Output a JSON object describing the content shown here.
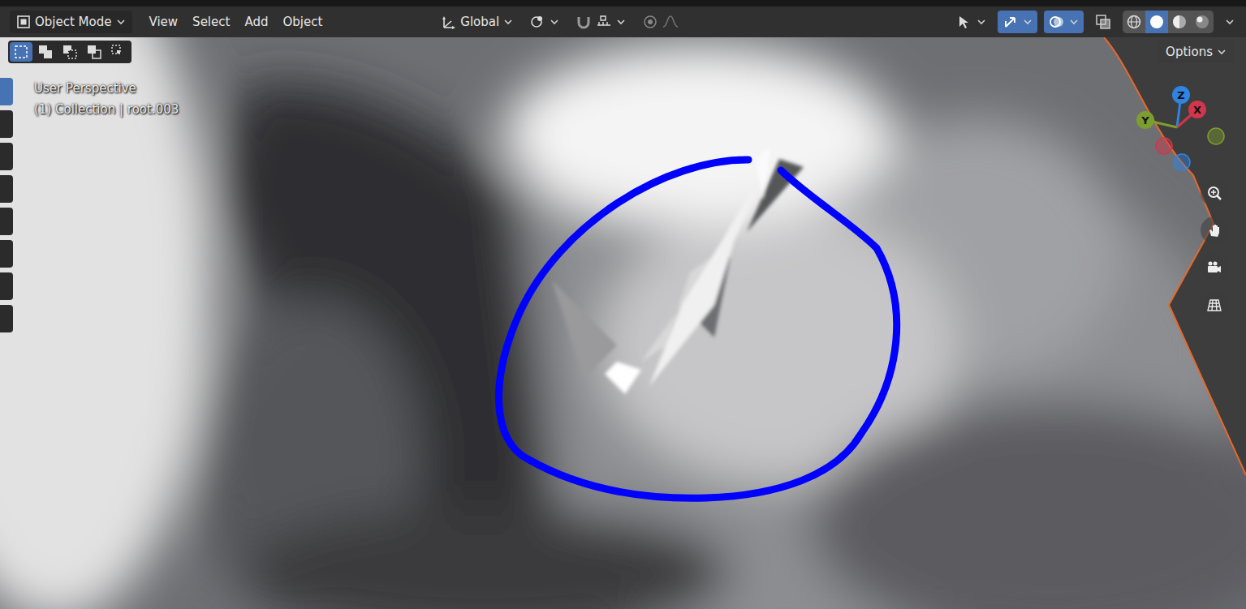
{
  "header": {
    "mode": "Object Mode",
    "menus": [
      "View",
      "Select",
      "Add",
      "Object"
    ],
    "orientation": "Global"
  },
  "tool_settings": {
    "options": "Options",
    "select_modes": [
      {
        "kind": "set",
        "selected": true
      },
      {
        "kind": "extend",
        "selected": false
      },
      {
        "kind": "subtract",
        "selected": false
      },
      {
        "kind": "invert",
        "selected": false
      },
      {
        "kind": "intersect",
        "selected": false
      }
    ]
  },
  "viewport": {
    "view": "User Perspective",
    "object": "(1) Collection | root.003"
  },
  "toolbar": [
    {
      "selected": true
    },
    {
      "selected": false
    },
    {
      "selected": false
    },
    {
      "selected": false
    },
    {
      "selected": false
    },
    {
      "selected": false
    },
    {
      "selected": false
    },
    {
      "selected": false
    }
  ],
  "gizmo": {
    "axes": [
      {
        "label": "Z",
        "color": "#2f83e3"
      },
      {
        "label": "X",
        "color": "#d0364c"
      },
      {
        "label": "Y",
        "color": "#7c9e2f"
      }
    ]
  },
  "view_toggles": [
    {
      "kind": "visibility",
      "on": false
    },
    {
      "kind": "gizmos",
      "on": true
    },
    {
      "kind": "overlays",
      "on": true
    },
    {
      "kind": "xray",
      "on": false
    }
  ],
  "shading": [
    {
      "kind": "wireframe",
      "selected": false
    },
    {
      "kind": "solid",
      "selected": true
    },
    {
      "kind": "material",
      "selected": false
    },
    {
      "kind": "rendered",
      "selected": false
    }
  ]
}
